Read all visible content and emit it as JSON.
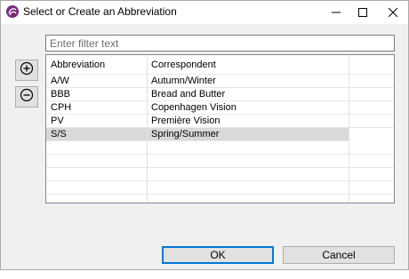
{
  "window": {
    "title": "Select or Create an Abbreviation"
  },
  "filter": {
    "placeholder": "Enter filter text",
    "value": ""
  },
  "toolbar": {
    "add_icon": "plus-circle-icon",
    "remove_icon": "minus-circle-icon"
  },
  "table": {
    "columns": [
      "Abbreviation",
      "Correspondent"
    ],
    "rows": [
      {
        "abbr": "A/W",
        "corr": "Autumn/Winter"
      },
      {
        "abbr": "BBB",
        "corr": "Bread and Butter"
      },
      {
        "abbr": "CPH",
        "corr": "Copenhagen Vision"
      },
      {
        "abbr": "PV",
        "corr": "Première Vision"
      },
      {
        "abbr": "S/S",
        "corr": "Spring/Summer"
      }
    ],
    "selected_index": 4
  },
  "buttons": {
    "ok": "OK",
    "cancel": "Cancel"
  },
  "colors": {
    "selection": "#d9d9d9",
    "default_button_border": "#0078d7",
    "app_icon": "#7a2a7c"
  }
}
